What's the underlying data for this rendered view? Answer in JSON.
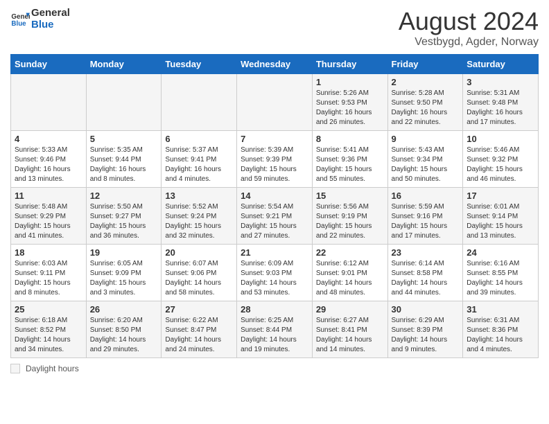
{
  "header": {
    "logo_line1": "General",
    "logo_line2": "Blue",
    "title": "August 2024",
    "subtitle": "Vestbygd, Agder, Norway"
  },
  "footer": {
    "daylight_label": "Daylight hours"
  },
  "columns": [
    "Sunday",
    "Monday",
    "Tuesday",
    "Wednesday",
    "Thursday",
    "Friday",
    "Saturday"
  ],
  "weeks": [
    [
      {
        "day": "",
        "info": ""
      },
      {
        "day": "",
        "info": ""
      },
      {
        "day": "",
        "info": ""
      },
      {
        "day": "",
        "info": ""
      },
      {
        "day": "1",
        "info": "Sunrise: 5:26 AM\nSunset: 9:53 PM\nDaylight: 16 hours\nand 26 minutes."
      },
      {
        "day": "2",
        "info": "Sunrise: 5:28 AM\nSunset: 9:50 PM\nDaylight: 16 hours\nand 22 minutes."
      },
      {
        "day": "3",
        "info": "Sunrise: 5:31 AM\nSunset: 9:48 PM\nDaylight: 16 hours\nand 17 minutes."
      }
    ],
    [
      {
        "day": "4",
        "info": "Sunrise: 5:33 AM\nSunset: 9:46 PM\nDaylight: 16 hours\nand 13 minutes."
      },
      {
        "day": "5",
        "info": "Sunrise: 5:35 AM\nSunset: 9:44 PM\nDaylight: 16 hours\nand 8 minutes."
      },
      {
        "day": "6",
        "info": "Sunrise: 5:37 AM\nSunset: 9:41 PM\nDaylight: 16 hours\nand 4 minutes."
      },
      {
        "day": "7",
        "info": "Sunrise: 5:39 AM\nSunset: 9:39 PM\nDaylight: 15 hours\nand 59 minutes."
      },
      {
        "day": "8",
        "info": "Sunrise: 5:41 AM\nSunset: 9:36 PM\nDaylight: 15 hours\nand 55 minutes."
      },
      {
        "day": "9",
        "info": "Sunrise: 5:43 AM\nSunset: 9:34 PM\nDaylight: 15 hours\nand 50 minutes."
      },
      {
        "day": "10",
        "info": "Sunrise: 5:46 AM\nSunset: 9:32 PM\nDaylight: 15 hours\nand 46 minutes."
      }
    ],
    [
      {
        "day": "11",
        "info": "Sunrise: 5:48 AM\nSunset: 9:29 PM\nDaylight: 15 hours\nand 41 minutes."
      },
      {
        "day": "12",
        "info": "Sunrise: 5:50 AM\nSunset: 9:27 PM\nDaylight: 15 hours\nand 36 minutes."
      },
      {
        "day": "13",
        "info": "Sunrise: 5:52 AM\nSunset: 9:24 PM\nDaylight: 15 hours\nand 32 minutes."
      },
      {
        "day": "14",
        "info": "Sunrise: 5:54 AM\nSunset: 9:21 PM\nDaylight: 15 hours\nand 27 minutes."
      },
      {
        "day": "15",
        "info": "Sunrise: 5:56 AM\nSunset: 9:19 PM\nDaylight: 15 hours\nand 22 minutes."
      },
      {
        "day": "16",
        "info": "Sunrise: 5:59 AM\nSunset: 9:16 PM\nDaylight: 15 hours\nand 17 minutes."
      },
      {
        "day": "17",
        "info": "Sunrise: 6:01 AM\nSunset: 9:14 PM\nDaylight: 15 hours\nand 13 minutes."
      }
    ],
    [
      {
        "day": "18",
        "info": "Sunrise: 6:03 AM\nSunset: 9:11 PM\nDaylight: 15 hours\nand 8 minutes."
      },
      {
        "day": "19",
        "info": "Sunrise: 6:05 AM\nSunset: 9:09 PM\nDaylight: 15 hours\nand 3 minutes."
      },
      {
        "day": "20",
        "info": "Sunrise: 6:07 AM\nSunset: 9:06 PM\nDaylight: 14 hours\nand 58 minutes."
      },
      {
        "day": "21",
        "info": "Sunrise: 6:09 AM\nSunset: 9:03 PM\nDaylight: 14 hours\nand 53 minutes."
      },
      {
        "day": "22",
        "info": "Sunrise: 6:12 AM\nSunset: 9:01 PM\nDaylight: 14 hours\nand 48 minutes."
      },
      {
        "day": "23",
        "info": "Sunrise: 6:14 AM\nSunset: 8:58 PM\nDaylight: 14 hours\nand 44 minutes."
      },
      {
        "day": "24",
        "info": "Sunrise: 6:16 AM\nSunset: 8:55 PM\nDaylight: 14 hours\nand 39 minutes."
      }
    ],
    [
      {
        "day": "25",
        "info": "Sunrise: 6:18 AM\nSunset: 8:52 PM\nDaylight: 14 hours\nand 34 minutes."
      },
      {
        "day": "26",
        "info": "Sunrise: 6:20 AM\nSunset: 8:50 PM\nDaylight: 14 hours\nand 29 minutes."
      },
      {
        "day": "27",
        "info": "Sunrise: 6:22 AM\nSunset: 8:47 PM\nDaylight: 14 hours\nand 24 minutes."
      },
      {
        "day": "28",
        "info": "Sunrise: 6:25 AM\nSunset: 8:44 PM\nDaylight: 14 hours\nand 19 minutes."
      },
      {
        "day": "29",
        "info": "Sunrise: 6:27 AM\nSunset: 8:41 PM\nDaylight: 14 hours\nand 14 minutes."
      },
      {
        "day": "30",
        "info": "Sunrise: 6:29 AM\nSunset: 8:39 PM\nDaylight: 14 hours\nand 9 minutes."
      },
      {
        "day": "31",
        "info": "Sunrise: 6:31 AM\nSunset: 8:36 PM\nDaylight: 14 hours\nand 4 minutes."
      }
    ]
  ]
}
